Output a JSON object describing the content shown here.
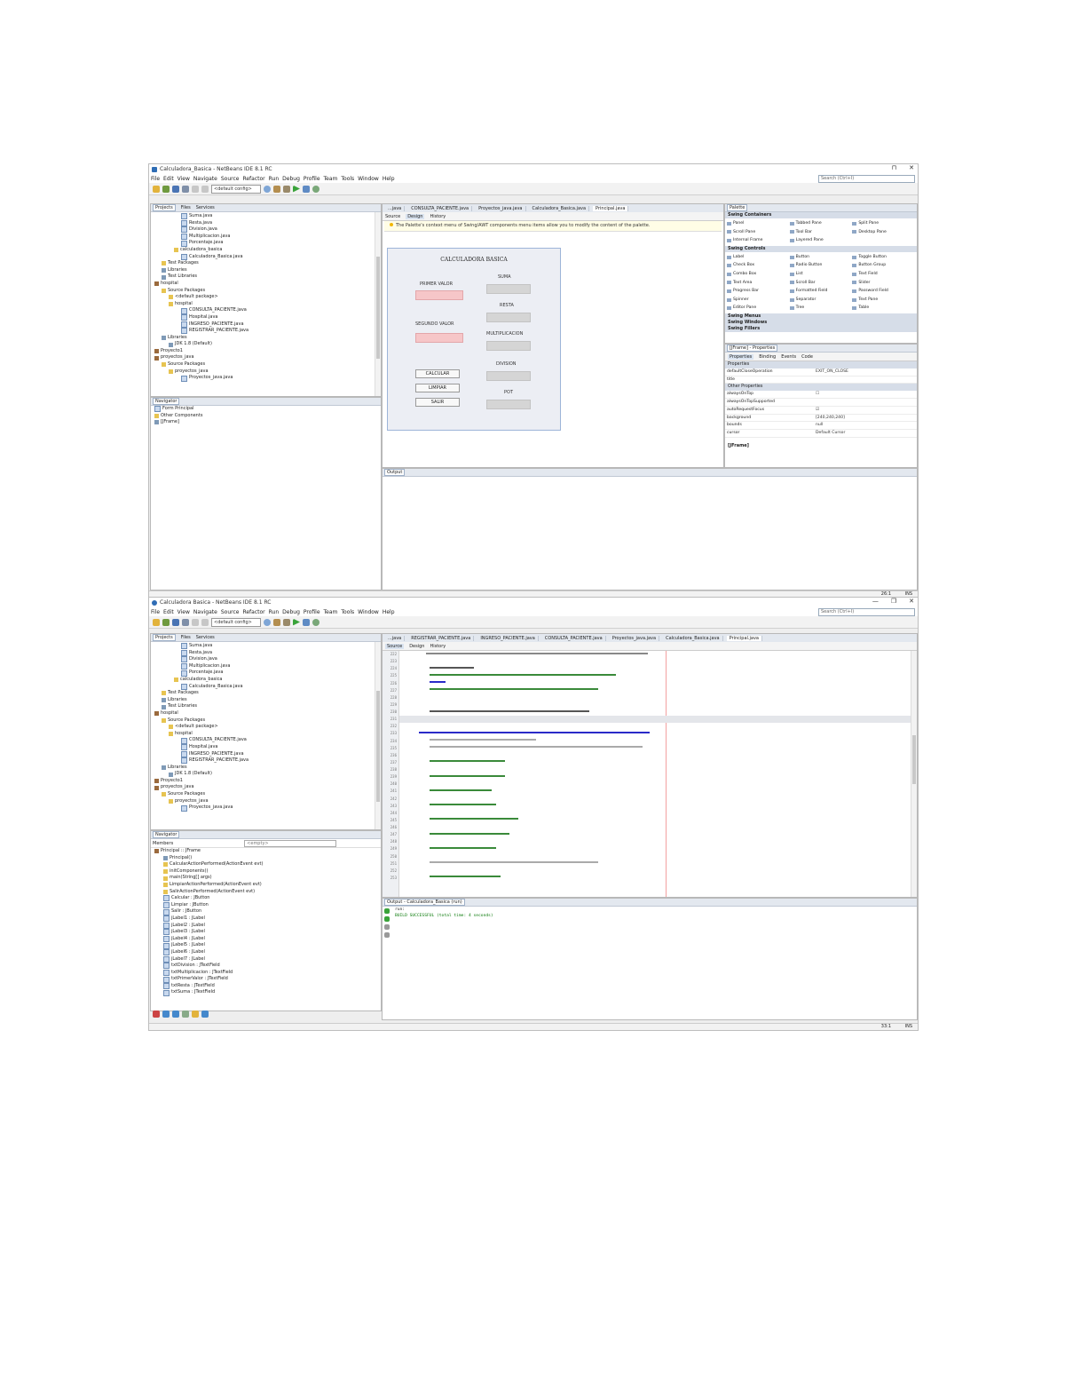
{
  "shot1": {
    "window_title": "Calculadora_Basica - NetBeans IDE 8.1 RC",
    "win_controls": [
      "⊓",
      "✕"
    ],
    "menu": [
      "File",
      "Edit",
      "View",
      "Navigate",
      "Source",
      "Refactor",
      "Run",
      "Debug",
      "Profile",
      "Team",
      "Tools",
      "Window",
      "Help"
    ],
    "search_placeholder": "Search (Ctrl+I)",
    "config_select": "<default config>",
    "left_tabs": [
      "Projects",
      "Files",
      "Services"
    ],
    "tree": [
      "Suma.java",
      "Resta.java",
      "Division.java",
      "Multiplicacion.java",
      "Porcentaje.java",
      "calculadora_basica",
      "Calculadora_Basica.java",
      "Test Packages",
      "Libraries",
      "Test Libraries",
      "hospital",
      "Source Packages",
      "<default package>",
      "hospital",
      "CONSULTA_PACIENTE.java",
      "Hospital.java",
      "INGRESO_PACIENTE.java",
      "REGISTRAR_PACIENTE.java",
      "Libraries",
      "JDK 1.8 (Default)",
      "Proyecto1",
      "proyectos_java",
      "Source Packages",
      "proyectos_java",
      "Proyectos_java.java"
    ],
    "navigator_title": "Navigator",
    "navigator_items": [
      "Form Principal",
      "Other Components",
      "[JFrame]"
    ],
    "editor_tabs": [
      "...java",
      "CONSULTA_PACIENTE.java",
      "Proyectos_java.java",
      "Calculadora_Basica.java",
      "Principal.java"
    ],
    "subtabs": [
      "Source",
      "Design",
      "History"
    ],
    "hint": "The Palette's context menu of Swing/AWT components menu items allow you to modify the content of the palette.",
    "form": {
      "title": "CALCULADORA BASICA",
      "primer_label": "PRIMER VALOR",
      "segundo_label": "SEGUNDO VALOR",
      "suma_label": "SUMA",
      "resta_label": "RESTA",
      "mult_label": "MULTIPLICACION",
      "div_label": "DIVISION",
      "pot_label": "POT",
      "btn_calcular": "CALCULAR",
      "btn_limpiar": "LIMPIAR",
      "btn_salir": "SALIR"
    },
    "palette_title": "Palette",
    "palette_sections": [
      "Swing Containers",
      "Swing Controls",
      "Swing Menus",
      "Swing Windows",
      "Swing Fillers"
    ],
    "palette_containers": [
      "Panel",
      "Tabbed Pane",
      "Split Pane",
      "Scroll Pane",
      "Tool Bar",
      "Desktop Pane",
      "Internal Frame",
      "Layered Pane"
    ],
    "palette_controls": [
      "Label",
      "Button",
      "Toggle Button",
      "Check Box",
      "Radio Button",
      "Button Group",
      "Combo Box",
      "List",
      "Text Field",
      "Text Area",
      "Scroll Bar",
      "Slider",
      "Progress Bar",
      "Formatted Field",
      "Password Field",
      "Spinner",
      "Separator",
      "Text Pane",
      "Editor Pane",
      "Tree",
      "Table"
    ],
    "props_title": "[JFrame] - Properties",
    "props_tabs": [
      "Properties",
      "Binding",
      "Events",
      "Code"
    ],
    "props_section": "Properties",
    "props": [
      {
        "k": "defaultCloseOperation",
        "v": "EXIT_ON_CLOSE"
      },
      {
        "k": "title",
        "v": ""
      },
      {
        "k": "Other Properties",
        "v": "",
        "sec": true
      },
      {
        "k": "alwaysOnTop",
        "v": "☐"
      },
      {
        "k": "alwaysOnTopSupported",
        "v": ""
      },
      {
        "k": "autoRequestFocus",
        "v": "☑"
      },
      {
        "k": "background",
        "v": "[240,240,240]"
      },
      {
        "k": "bounds",
        "v": "null"
      },
      {
        "k": "cursor",
        "v": "Default Cursor"
      }
    ],
    "jframe_label": "[JFrame]",
    "output_title": "Output",
    "status_right": [
      "26:1",
      "INS"
    ]
  },
  "shot2": {
    "window_title": "Calculadora Basica - NetBeans IDE 8.1 RC",
    "win_controls": [
      "—",
      "❐",
      "✕"
    ],
    "menu": [
      "File",
      "Edit",
      "View",
      "Navigate",
      "Source",
      "Refactor",
      "Run",
      "Debug",
      "Profile",
      "Team",
      "Tools",
      "Window",
      "Help"
    ],
    "search_placeholder": "Search (Ctrl+I)",
    "config_select": "<default config>",
    "left_tabs": [
      "Projects",
      "Files",
      "Services"
    ],
    "tree": [
      "Suma.java",
      "Resta.java",
      "Division.java",
      "Multiplicacion.java",
      "Porcentaje.java",
      "calculadora_basica",
      "Calculadora_Basica.java",
      "Test Packages",
      "Libraries",
      "Test Libraries",
      "hospital",
      "Source Packages",
      "<default package>",
      "hospital",
      "CONSULTA_PACIENTE.java",
      "Hospital.java",
      "INGRESO_PACIENTE.java",
      "REGISTRAR_PACIENTE.java",
      "Libraries",
      "JDK 1.8 (Default)",
      "Proyecto1",
      "proyectos_java",
      "Source Packages",
      "proyectos_java",
      "Proyectos_java.java"
    ],
    "navigator_title": "Navigator",
    "members_label": "Members",
    "members_filter": "<empty>",
    "navigator_items": [
      "Principal :: JFrame",
      "Principal()",
      "CalcularActionPerformed(ActionEvent evt)",
      "initComponents()",
      "main(String[] args)",
      "LimpiarActionPerformed(ActionEvent evt)",
      "SalirActionPerformed(ActionEvent evt)",
      "Calcular : JButton",
      "Limpiar : JButton",
      "Salir : JButton",
      "jLabel1 : JLabel",
      "jLabel2 : JLabel",
      "jLabel3 : JLabel",
      "jLabel4 : JLabel",
      "jLabel5 : JLabel",
      "jLabel6 : JLabel",
      "jLabel7 : JLabel",
      "txtDivision : JTextField",
      "txtMultiplicacion : JTextField",
      "txtPrimerValor : JTextField",
      "txtResta : JTextField",
      "txtSuma : JTextField"
    ],
    "editor_tabs": [
      "...java",
      "REGISTRAR_PACIENTE.java",
      "INGRESO_PACIENTE.java",
      "CONSULTA_PACIENTE.java",
      "Proyectos_java.java",
      "Calculadora_Basica.java",
      "Principal.java"
    ],
    "subtabs": [
      "Source",
      "Design",
      "History"
    ],
    "line_numbers": [
      "222",
      "223",
      "224",
      "225",
      "226",
      "227",
      "228",
      "229",
      "230",
      "231",
      "232",
      "233",
      "234",
      "235",
      "236",
      "237",
      "238",
      "239",
      "240",
      "241",
      "242",
      "243",
      "244",
      "245",
      "246",
      "247",
      "248",
      "249",
      "250",
      "251",
      "252",
      "253"
    ],
    "output_title": "Output - Calculadora_Basica (run)",
    "output_lines": [
      "run:",
      "BUILD SUCCESSFUL (total time: 4 seconds)"
    ],
    "status_right": [
      "33:1",
      "INS"
    ]
  }
}
